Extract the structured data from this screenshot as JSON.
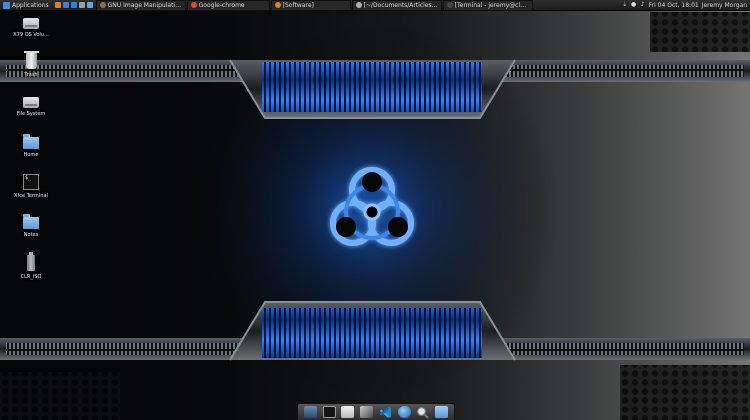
{
  "top_panel": {
    "applications_label": "Applications",
    "tasks": [
      {
        "label": "GNU Image Manipulation ...",
        "color": "#8a6f4e"
      },
      {
        "label": "Google-chrome",
        "color": "#e0463a"
      },
      {
        "label": "[Software]",
        "color": "#c98a2b"
      },
      {
        "label": "[~/Documents/Articles/Cl...",
        "color": "#b0b0b0"
      },
      {
        "label": "[Terminal - jeremy@clear...",
        "color": "#333333"
      }
    ],
    "clock": "Fri 04 Oct, 18:01",
    "user": "Jeremy Morgan"
  },
  "desktop": {
    "icons": [
      {
        "label": "X79 OS Volu...",
        "icon": "drive-icon"
      },
      {
        "label": "Trash",
        "icon": "trash-icon"
      },
      {
        "label": "File System",
        "icon": "drive-icon"
      },
      {
        "label": "Home",
        "icon": "home-folder-icon"
      },
      {
        "label": "Xfce Terminal",
        "icon": "terminal-icon"
      },
      {
        "label": "Notes",
        "icon": "folder-icon"
      },
      {
        "label": "CLR_ISO",
        "icon": "usb-drive-icon"
      }
    ]
  },
  "dock": {
    "items": [
      "desktop-icon",
      "terminal-icon",
      "files-icon",
      "tools-icon",
      "vscode-icon",
      "browser-icon",
      "search-icon",
      "folder-icon"
    ]
  },
  "colors": {
    "accent_blue": "#1e6ee8",
    "panel_bg": "#222222",
    "wallpaper_dark": "#050608"
  }
}
